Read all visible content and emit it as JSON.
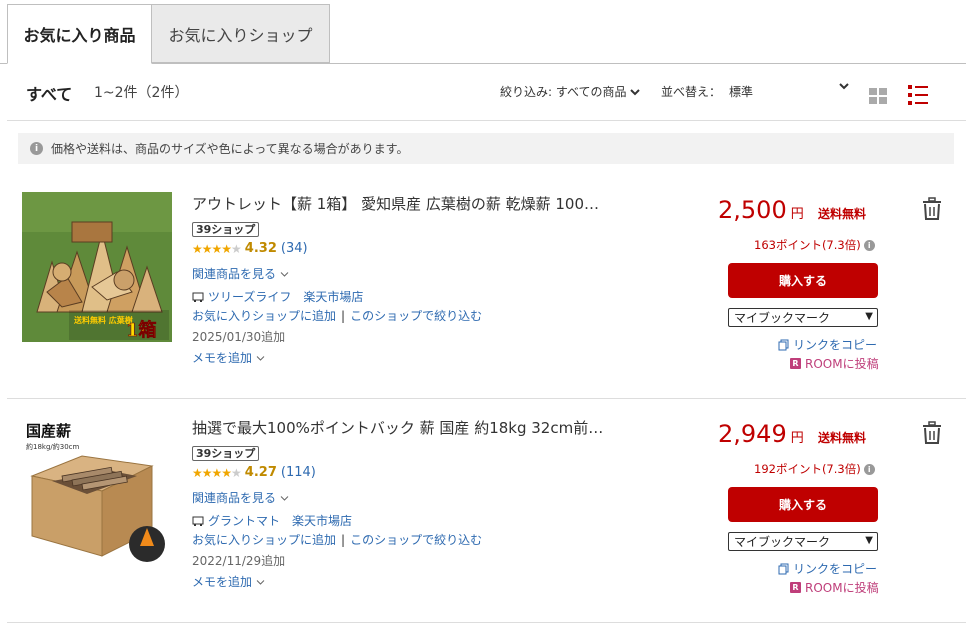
{
  "tabs": {
    "active_label": "お気に入り商品",
    "inactive_label": "お気に入りショップ"
  },
  "toolbar": {
    "all_label": "すべて",
    "count_label": "1~2件（2件）",
    "filter_label": "絞り込み: すべての商品",
    "sort_label": "並べ替え：",
    "sort_value": "標準",
    "view_grid_icon": "grid-view-icon",
    "view_list_icon": "list-view-icon"
  },
  "notice": {
    "text": "価格や送料は、商品のサイズや色によって異なる場合があります。"
  },
  "items": [
    {
      "title": "アウトレット【薪 1箱】 愛知県産 広葉樹の薪 乾燥薪 100…",
      "shop_badge": "39ショップ",
      "rating": "4.32",
      "review_count": "(34)",
      "stars_filled": 4,
      "related": "関連商品を見る",
      "shop_name": "ツリーズライフ　楽天市場店",
      "add_shop": "お気に入りショップに追加",
      "filter_shop": "このショップで絞り込む",
      "date": "2025/01/30追加",
      "memo": "メモを追加",
      "price": "2,500",
      "yen": "円",
      "free_shipping": "送料無料",
      "points": "163ポイント(7.3倍)",
      "buy": "購入する",
      "bookmark": "マイブックマーク",
      "copy_link": "リンクをコピー",
      "room": "ROOMに投稿",
      "thumb_text_small": "送料無料 広葉樹",
      "thumb_text_big": "1箱"
    },
    {
      "title": "抽選で最大100%ポイントバック 薪 国産 約18kg 32cm前…",
      "shop_badge": "39ショップ",
      "rating": "4.27",
      "review_count": "(114)",
      "stars_filled": 4,
      "related": "関連商品を見る",
      "shop_name": "グラントマト　楽天市場店",
      "add_shop": "お気に入りショップに追加",
      "filter_shop": "このショップで絞り込む",
      "date": "2022/11/29追加",
      "memo": "メモを追加",
      "price": "2,949",
      "yen": "円",
      "free_shipping": "送料無料",
      "points": "192ポイント(7.3倍)",
      "buy": "購入する",
      "bookmark": "マイブックマーク",
      "copy_link": "リンクをコピー",
      "room": "ROOMに投稿",
      "thumb_title": "国産薪",
      "thumb_sub": "約18kg/約30cm"
    }
  ],
  "colors": {
    "accent": "#bf0000",
    "link": "#2e6ab0",
    "star": "#f0a600",
    "room": "#bf3e7a"
  }
}
